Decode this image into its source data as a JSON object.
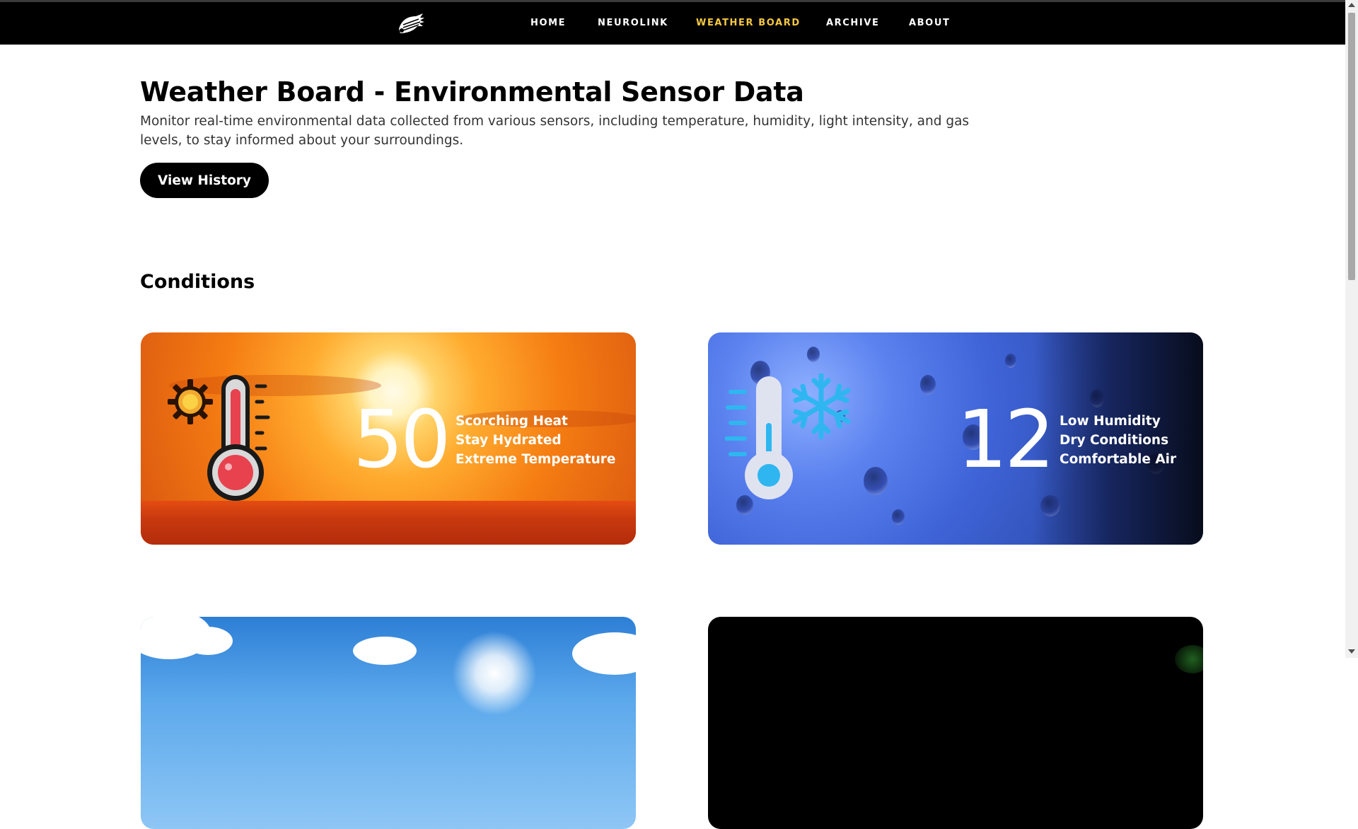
{
  "nav": {
    "logo_icon": "bird-logo-icon",
    "items": [
      {
        "label": "HOME",
        "active": false
      },
      {
        "label": "NEUROLINK",
        "active": false
      },
      {
        "label": "WEATHER BOARD",
        "active": true
      },
      {
        "label": "ARCHIVE",
        "active": false
      },
      {
        "label": "ABOUT",
        "active": false
      }
    ],
    "active_color": "#f5c842"
  },
  "header": {
    "title": "Weather Board - Environmental Sensor Data",
    "description": "Monitor real-time environmental data collected from various sensors, including temperature, humidity, light intensity, and gas levels, to stay informed about your surroundings.",
    "history_button": "View History"
  },
  "conditions": {
    "title": "Conditions",
    "cards": [
      {
        "icon": "thermometer-sun-icon",
        "value": "50",
        "lines": [
          "Scorching Heat",
          "Stay Hydrated",
          "Extreme Temperature"
        ]
      },
      {
        "icon": "thermometer-snowflake-icon",
        "value": "12",
        "lines": [
          "Low Humidity",
          "Dry Conditions",
          "Comfortable Air"
        ]
      }
    ]
  }
}
